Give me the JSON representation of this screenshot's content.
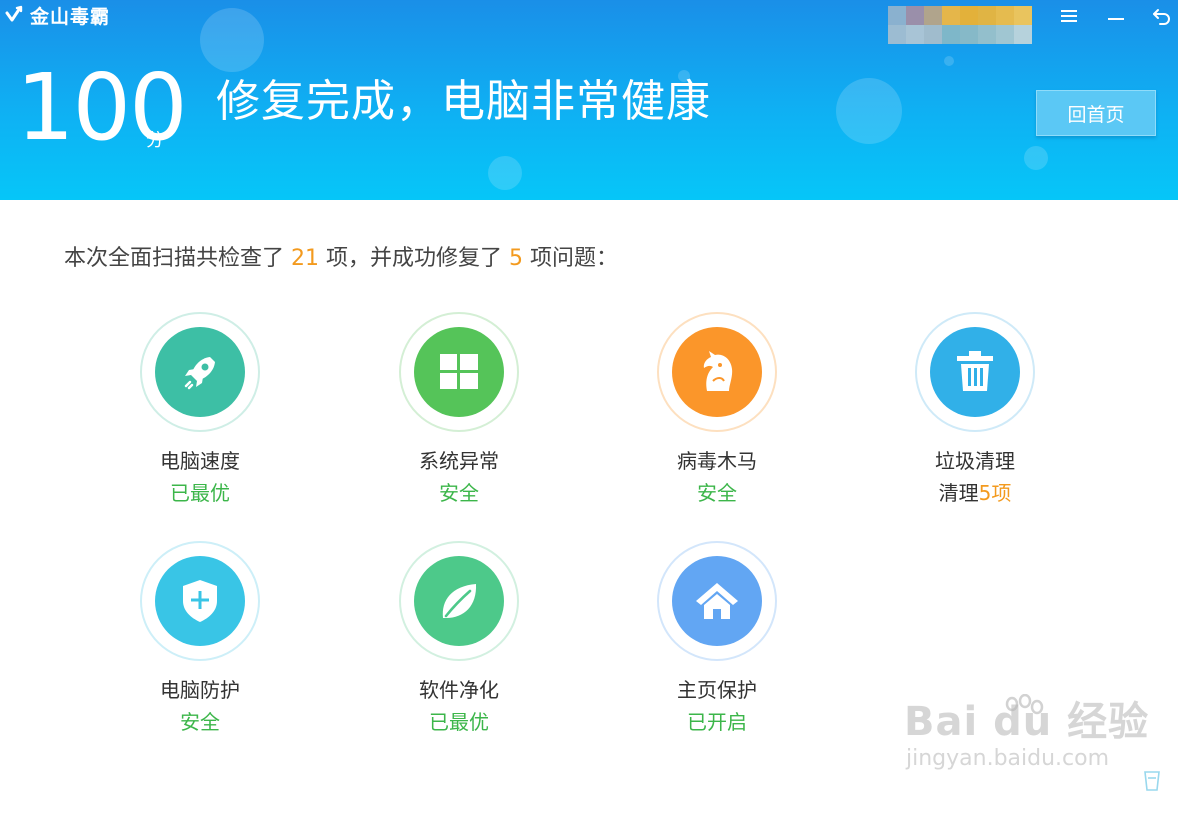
{
  "app": {
    "name": "金山毒霸"
  },
  "window": {
    "menu_icon": "menu-icon",
    "minimize_icon": "minimize-icon",
    "back_icon": "back-icon"
  },
  "header": {
    "score": "100",
    "score_unit": "分",
    "status_title": "修复完成，电脑非常健康",
    "home_button": "回首页"
  },
  "summary": {
    "prefix": "本次全面扫描共检查了",
    "checked_count": "21",
    "middle": "项，并成功修复了",
    "fixed_count": "5",
    "suffix": "项问题："
  },
  "items": [
    {
      "title": "电脑速度",
      "status": "已最优",
      "icon": "rocket-icon",
      "color": "#3dbfa5",
      "ring": "#cfeee6"
    },
    {
      "title": "系统异常",
      "status": "安全",
      "icon": "windows-icon",
      "color": "#55c459",
      "ring": "#d4efd5"
    },
    {
      "title": "病毒木马",
      "status": "安全",
      "icon": "horse-icon",
      "color": "#fb962a",
      "ring": "#fde0c0"
    },
    {
      "title": "垃圾清理",
      "status_prefix": "清理",
      "status_count": "5项",
      "icon": "trash-icon",
      "color": "#31b0e8",
      "ring": "#cfeaf8"
    },
    {
      "title": "电脑防护",
      "status": "安全",
      "icon": "shield-plus-icon",
      "color": "#39c5e6",
      "ring": "#cdeff8"
    },
    {
      "title": "软件净化",
      "status": "已最优",
      "icon": "leaf-icon",
      "color": "#4dc98a",
      "ring": "#d2f0e0"
    },
    {
      "title": "主页保护",
      "status": "已开启",
      "icon": "home-icon",
      "color": "#62a6f3",
      "ring": "#d3e6fb"
    }
  ],
  "watermark": {
    "brand": "Bai du 经验",
    "url": "jingyan.baidu.com"
  },
  "colors": {
    "accent_orange": "#f39a1e",
    "status_green": "#3cb64a",
    "header_blue": "#0fb0f3"
  }
}
